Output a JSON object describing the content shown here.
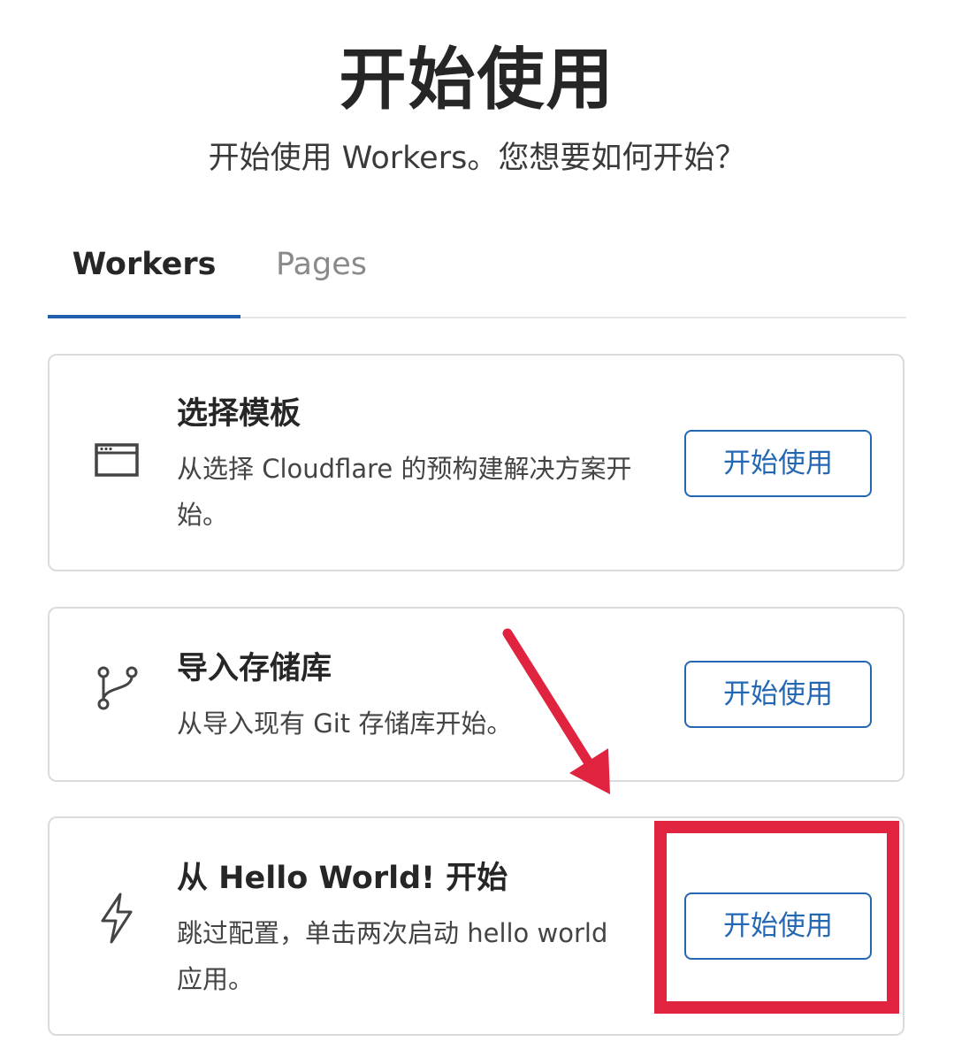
{
  "header": {
    "title": "开始使用",
    "subtitle": "开始使用 Workers。您想要如何开始？"
  },
  "tabs": [
    {
      "label": "Workers",
      "active": true
    },
    {
      "label": "Pages",
      "active": false
    }
  ],
  "cards": [
    {
      "icon": "browser-window-icon",
      "title": "选择模板",
      "description": "从选择 Cloudflare 的预构建解决方案开始。",
      "button_label": "开始使用"
    },
    {
      "icon": "git-branch-icon",
      "title": "导入存储库",
      "description": "从导入现有 Git 存储库开始。",
      "button_label": "开始使用"
    },
    {
      "icon": "lightning-bolt-icon",
      "title": "从 Hello World! 开始",
      "description": "跳过配置，单击两次启动 hello world 应用。",
      "button_label": "开始使用"
    }
  ],
  "annotation": {
    "arrow_color": "#e0233f",
    "highlight_color": "#e0233f"
  },
  "colors": {
    "accent": "#2468b4",
    "tab_underline": "#1f5fad"
  }
}
